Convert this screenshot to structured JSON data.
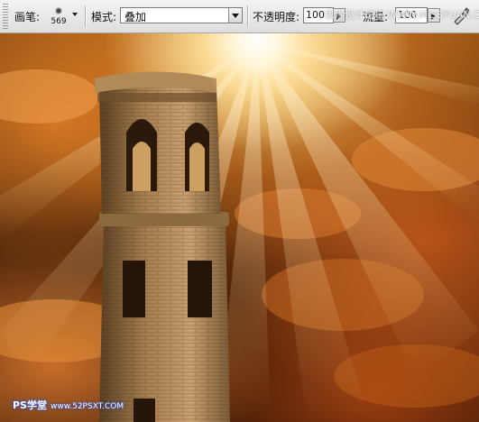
{
  "toolbar": {
    "brush_label": "画笔:",
    "brush_size": "569",
    "mode_label": "模式:",
    "mode_value": "叠加",
    "opacity_label": "不透明度:",
    "opacity_value": "100",
    "flow_label": "流量:",
    "flow_value": "100"
  },
  "watermark": {
    "text": "思缘设计论坛 WWW.MISSYUAN.COM"
  },
  "logo": {
    "brand": "PS学堂",
    "site": "www.52PSXT.COM"
  },
  "icons": [
    "brush-preview-icon",
    "dropdown-arrow-icon",
    "airbrush-icon"
  ],
  "colors": {
    "sun": "#fffbe8",
    "sky_orange": "#e8852a",
    "sky_dark": "#2a1004",
    "tower_stone": "#a07a4c"
  }
}
